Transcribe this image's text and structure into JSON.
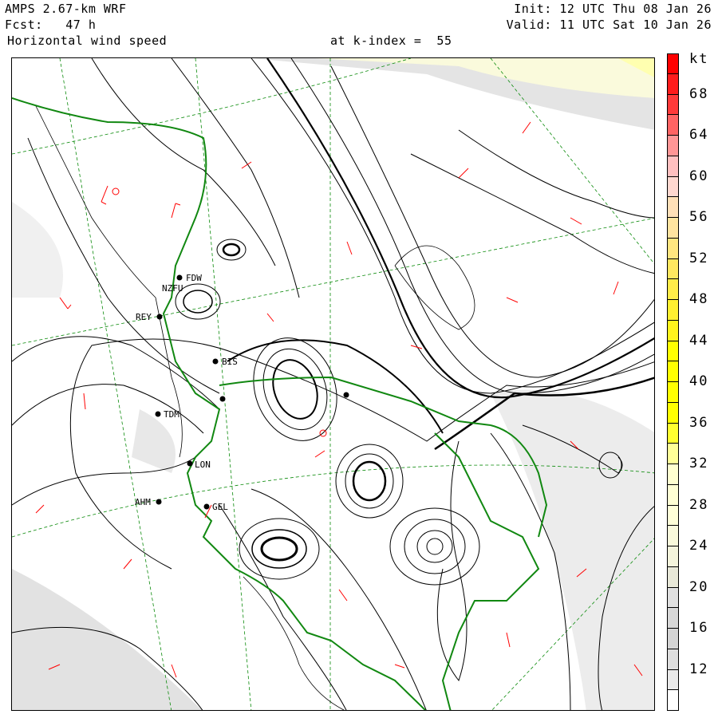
{
  "header": {
    "model": "AMPS 2.67-km WRF",
    "forecast": "Fcst:   47 h",
    "field": "Horizontal wind speed",
    "level": "at k-index =  55",
    "init": "Init: 12 UTC Thu 08 Jan 26",
    "valid": "Valid: 11 UTC Sat 10 Jan 26"
  },
  "colorbar": {
    "unit": "kt",
    "labels": [
      "68",
      "64",
      "60",
      "56",
      "52",
      "48",
      "44",
      "40",
      "36",
      "32",
      "28",
      "24",
      "20",
      "16",
      "12"
    ],
    "range_kt": [
      8,
      72
    ],
    "step_kt": 2,
    "colors": [
      "#ff0000",
      "#ff1c1c",
      "#ff3a3a",
      "#ff6464",
      "#ff9696",
      "#ffc0c0",
      "#ffd8d0",
      "#ffe0b8",
      "#ffe4a0",
      "#ffe680",
      "#ffe860",
      "#ffec48",
      "#fff030",
      "#fff41c",
      "#ffff00",
      "#ffff00",
      "#ffff00",
      "#ffff00",
      "#ffff30",
      "#ffff98",
      "#ffffd0",
      "#ffffd4",
      "#ffffd8",
      "#fafadc",
      "#f4f4dc",
      "#e8e8d8",
      "#e0e0e0",
      "#d8d8d8",
      "#d4d4d4",
      "#dedede",
      "#eaeaea",
      "#ffffff"
    ]
  },
  "stations": [
    {
      "id": "FDW"
    },
    {
      "id": "NZFU"
    },
    {
      "id": "REY"
    },
    {
      "id": "BIS"
    },
    {
      "id": "TDM"
    },
    {
      "id": "LON"
    },
    {
      "id": "AHM"
    },
    {
      "id": "GEL"
    }
  ]
}
